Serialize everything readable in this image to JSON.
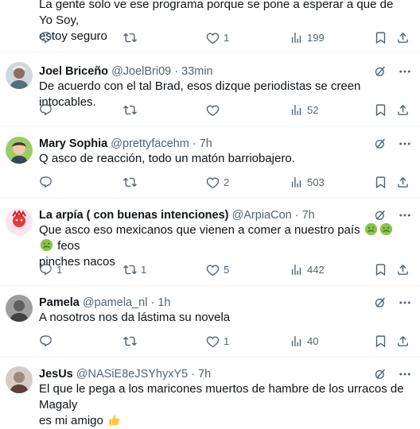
{
  "tweets": [
    {
      "text_lines": [
        "La gente solo ve ese programa porque se pone a esperar a que de Yo Soy,",
        "estoy seguro"
      ],
      "stats": {
        "replies": "",
        "retweets": "",
        "likes": "1",
        "views": "199"
      }
    },
    {
      "name": "Joel Briceño",
      "handle": "@JoelBri09",
      "time": "33min",
      "text_lines": [
        "De acuerdo con el tal Brad, esos dizque periodistas se creen intocables."
      ],
      "stats": {
        "replies": "",
        "retweets": "",
        "likes": "",
        "views": "52"
      }
    },
    {
      "name": "Mary Sophia",
      "handle": "@prettyfacehm",
      "time": "7h",
      "text_lines": [
        "Q asco de reacción, todo un matón barriobajero."
      ],
      "stats": {
        "replies": "",
        "retweets": "",
        "likes": "2",
        "views": "503"
      }
    },
    {
      "name": "La arpía ( con buenas intenciones)",
      "handle": "@ArpiaCon",
      "time": "7h",
      "text_line1_before": "Que asco eso mexicanos que vienen a comer a nuestro país",
      "text_line1_after": "feos",
      "text_line2": "pinches nacos",
      "stats": {
        "replies": "1",
        "retweets": "1",
        "likes": "5",
        "views": "442"
      }
    },
    {
      "name": "Pamela",
      "handle": "@pamela_nl",
      "time": "1h",
      "text_lines": [
        "A nosotros nos da lástima su novela"
      ],
      "stats": {
        "replies": "",
        "retweets": "",
        "likes": "1",
        "views": "40"
      }
    },
    {
      "name": "JesUs",
      "handle": "@NASiE8eJSYhyxY5",
      "time": "7h",
      "text_lines": [
        "El que le pega a los maricones muertos de hambre de los urracos de Magaly",
        "es mi amigo"
      ]
    }
  ],
  "separator": " · ",
  "icons": {
    "reply": "reply-icon",
    "retweet": "retweet-icon",
    "like": "heart-icon",
    "views": "views-icon",
    "bookmark": "bookmark-icon",
    "share": "share-icon",
    "grok": "grok-icon",
    "more": "more-icon",
    "emoji_sick": "nauseated-face-emoji",
    "emoji_thumbs": "thumbs-up-emoji"
  },
  "colors": {
    "text": "#0f1419",
    "muted": "#536471",
    "divider": "#eff3f4"
  }
}
